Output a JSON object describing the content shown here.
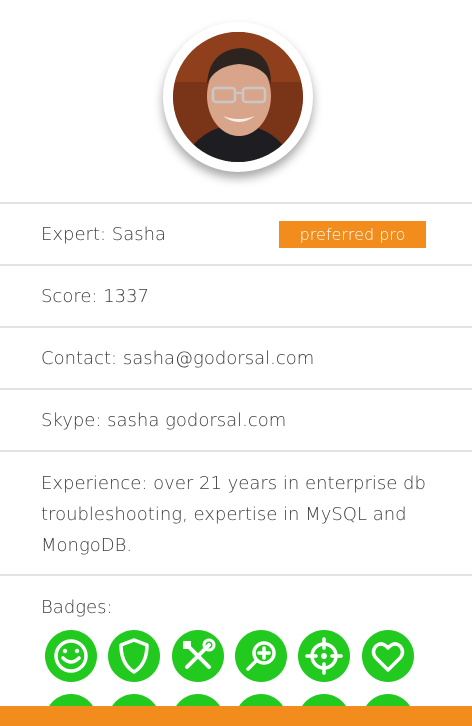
{
  "profile": {
    "expert_text": "Expert: Sasha",
    "preferred_badge": "preferred pro",
    "score_text": "Score: 1337",
    "contact_text": "Contact: sasha@godorsal.com",
    "skype_text": "Skype: sasha godorsal.com",
    "experience_text": "Experience: over 21 years in enterprise db troubleshooting, expertise in MySQL and MongoDB.",
    "badges_title": "Badges:"
  },
  "badges": [
    {
      "icon": "smiley-icon"
    },
    {
      "icon": "shield-icon"
    },
    {
      "icon": "tools-icon"
    },
    {
      "icon": "magnifier-plus-icon"
    },
    {
      "icon": "crosshair-icon"
    },
    {
      "icon": "heart-icon"
    },
    {
      "icon": "badge-icon-7"
    },
    {
      "icon": "badge-icon-8"
    },
    {
      "icon": "badge-icon-9"
    },
    {
      "icon": "badge-icon-10"
    },
    {
      "icon": "badge-icon-11"
    },
    {
      "icon": "badge-icon-12"
    }
  ],
  "colors": {
    "accent": "#f28c1d",
    "badge_green": "#22c91e",
    "divider": "#e3e3e3",
    "text": "#3d3d3d"
  }
}
